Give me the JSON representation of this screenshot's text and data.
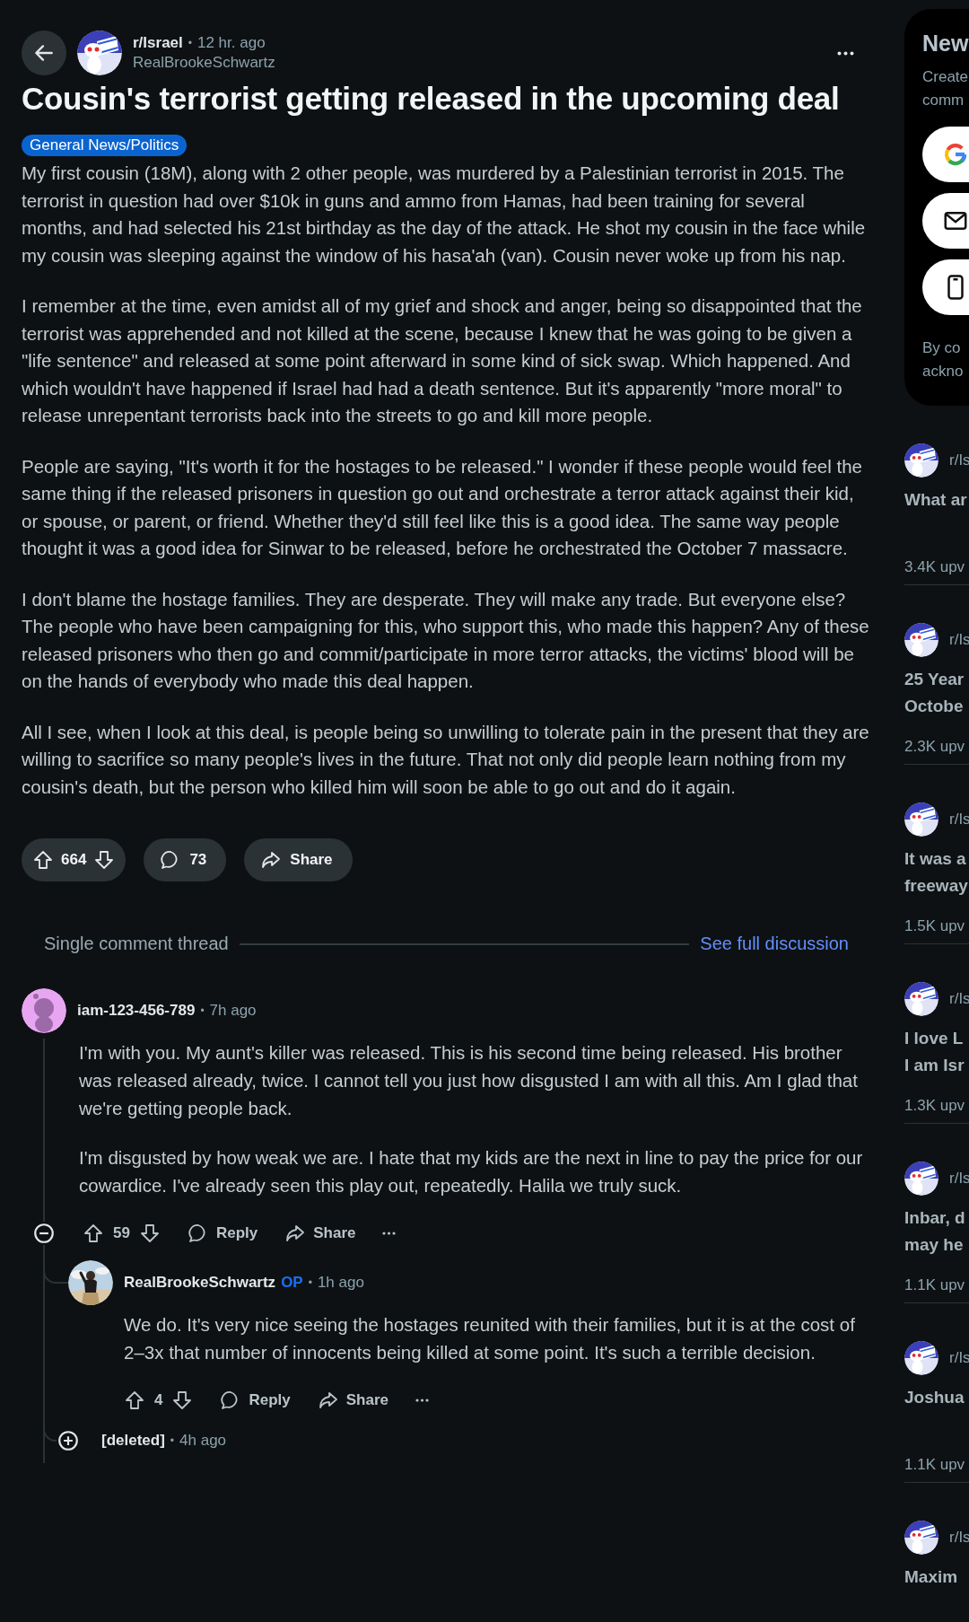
{
  "post": {
    "subreddit": "r/Israel",
    "separator": "•",
    "time": "12 hr. ago",
    "author": "RealBrookeSchwartz",
    "title": "Cousin's terrorist getting released in the upcoming deal",
    "flair": "General News/Politics",
    "paragraphs": [
      "My first cousin (18M), along with 2 other people, was murdered by a Palestinian terrorist in 2015. The terrorist in question had over $10k in guns and ammo from Hamas, had been training for several months, and had selected his 21st birthday as the day of the attack. He shot my cousin in the face while my cousin was sleeping against the window of his hasa'ah (van). Cousin never woke up from his nap.",
      "I remember at the time, even amidst all of my grief and shock and anger, being so disappointed that the terrorist was apprehended and not killed at the scene, because I knew that he was going to be given a \"life sentence\" and released at some point afterward in some kind of sick swap. Which happened. And which wouldn't have happened if Israel had had a death sentence. But it's apparently \"more moral\" to release unrepentant terrorists back into the streets to go and kill more people.",
      "People are saying, \"It's worth it for the hostages to be released.\" I wonder if these people would feel the same thing if the released prisoners in question go out and orchestrate a terror attack against their kid, or spouse, or parent, or friend. Whether they'd still feel like this is a good idea. The same way people thought it was a good idea for Sinwar to be released, before he orchestrated the October 7 massacre.",
      "I don't blame the hostage families. They are desperate. They will make any trade. But everyone else? The people who have been campaigning for this, who support this, who made this happen? Any of these released prisoners who then go and commit/participate in more terror attacks, the victims' blood will be on the hands of everybody who made this deal happen.",
      "All I see, when I look at this deal, is people being so unwilling to tolerate pain in the present that they are willing to sacrifice so many people's lives in the future. That not only did people learn nothing from my cousin's death, but the person who killed him will soon be able to go out and do it again."
    ],
    "votes": "664",
    "comments": "73",
    "share": "Share"
  },
  "thread": {
    "label": "Single comment thread",
    "link": "See full discussion"
  },
  "comments": [
    {
      "kind": "avatar",
      "author": "iam-123-456-789",
      "separator": "•",
      "time": "7h ago",
      "expanded": true,
      "paragraphs": [
        "I'm with you. My aunt's killer was released. This is his second time being released. His brother was released already, twice. I cannot tell you just how disgusted I am with all this. Am I glad that we're getting people back.",
        "I'm disgusted by how weak we are. I hate that my kids are the next in line to pay the price for our cowardice. I've already seen this play out, repeatedly. Halila we truly suck."
      ],
      "votes": "59",
      "reply": "Reply",
      "share": "Share",
      "children": [
        {
          "kind": "picture",
          "author": "RealBrookeSchwartz",
          "badge": "OP",
          "separator": "•",
          "time": "1h ago",
          "paragraphs": [
            "We do. It's very nice seeing the hostages reunited with their families, but it is at the cost of 2–3x that number of innocents being killed at some point. It's such a terrible decision."
          ],
          "votes": "4",
          "reply": "Reply",
          "share": "Share"
        },
        {
          "kind": "toggle",
          "author": "[deleted]",
          "separator": "•",
          "time": "4h ago",
          "expanded": false
        }
      ]
    }
  ],
  "sidebar": {
    "signup": {
      "heading": "New",
      "lines": [
        "Create",
        "comm"
      ],
      "buttons": [
        {
          "kind": "google"
        },
        {
          "kind": "email"
        },
        {
          "kind": "phone"
        }
      ],
      "legal": [
        "By co",
        "ackno"
      ]
    },
    "feed": [
      {
        "community": "r/Is",
        "title": [
          "What ar"
        ],
        "votes": "3.4K upv"
      },
      {
        "community": "r/Is",
        "title": [
          "25 Year",
          "Octobe"
        ],
        "votes": "2.3K upv"
      },
      {
        "community": "r/Is",
        "title": [
          "It was a",
          "freeway"
        ],
        "votes": "1.5K upv"
      },
      {
        "community": "r/Is",
        "title": [
          "I love L",
          "I am Isr"
        ],
        "votes": "1.3K upv"
      },
      {
        "community": "r/Is",
        "title": [
          "Inbar, d",
          "may he"
        ],
        "votes": "1.1K upv"
      },
      {
        "community": "r/Is",
        "title": [
          "Joshua"
        ],
        "votes": "1.1K upv"
      },
      {
        "community": "r/Is",
        "title": [
          "Maxim"
        ]
      }
    ]
  }
}
